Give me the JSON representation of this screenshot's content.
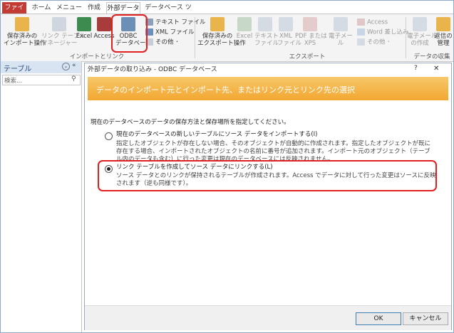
{
  "tabs": {
    "file": "ファイル",
    "home": "ホーム",
    "menu": "メニュー",
    "create": "作成",
    "external": "外部データ",
    "dbtools": "データベース ツール"
  },
  "ribbon": {
    "saved_import": "保存済みの\nインポート操作",
    "link_manager": "リンク テーブル\nマネージャー",
    "excel": "Excel",
    "access": "Access",
    "odbc": "ODBC\nデータベース",
    "text_file": "テキスト ファイル",
    "xml_file": "XML ファイル",
    "more_import": "その他 ･",
    "import_group": "インポートとリンク",
    "saved_export": "保存済みの\nエクスポート操作",
    "excel_export": "Excel",
    "text_export": "テキスト\nファイル",
    "xml_export": "XML\nファイル",
    "pdf_export": "PDF または\nXPS",
    "email": "電子メール",
    "access_export": "Access",
    "word_merge": "Word 差し込み",
    "more_export": "その他 ･",
    "export_group": "エクスポート",
    "email_create": "電子メール\nの作成",
    "reply_manage": "返信の\n管理",
    "collect_group": "データの収集"
  },
  "nav": {
    "title": "テーブル",
    "search_placeholder": "検索..."
  },
  "dialog": {
    "title": "外部データの取り込み - ODBC データベース",
    "help": "?",
    "close": "✕",
    "banner": "データのインポート元とインポート先、またはリンク元とリンク先の選択",
    "prompt": "現在のデータベースのデータの保存方法と保存場所を指定してください。",
    "option1_label": "現在のデータベースの新しいテーブルにソース データをインポートする(I)",
    "option1_desc": "指定したオブジェクトが存在しない場合、そのオブジェクトが自動的に作成されます。指定したオブジェクトが既に存在する場合、インポートされたオブジェクトの名前に番号が追加されます。インポート元のオブジェクト（テーブル内のデータも含む）に行った変更は現在のデータベースには反映されません。",
    "option2_label": "リンク テーブルを作成してソース データにリンクする(L)",
    "option2_desc": "ソース データとのリンクが保持されるテーブルが作成されます。Access でデータに対して行った変更はソースに反映されます（逆も同様です）。",
    "selected_option": "option2",
    "ok": "OK",
    "cancel": "キャンセル"
  },
  "colors": {
    "file_tab": "#c33b35",
    "banner": "#f2a731",
    "highlight": "#e02020"
  }
}
